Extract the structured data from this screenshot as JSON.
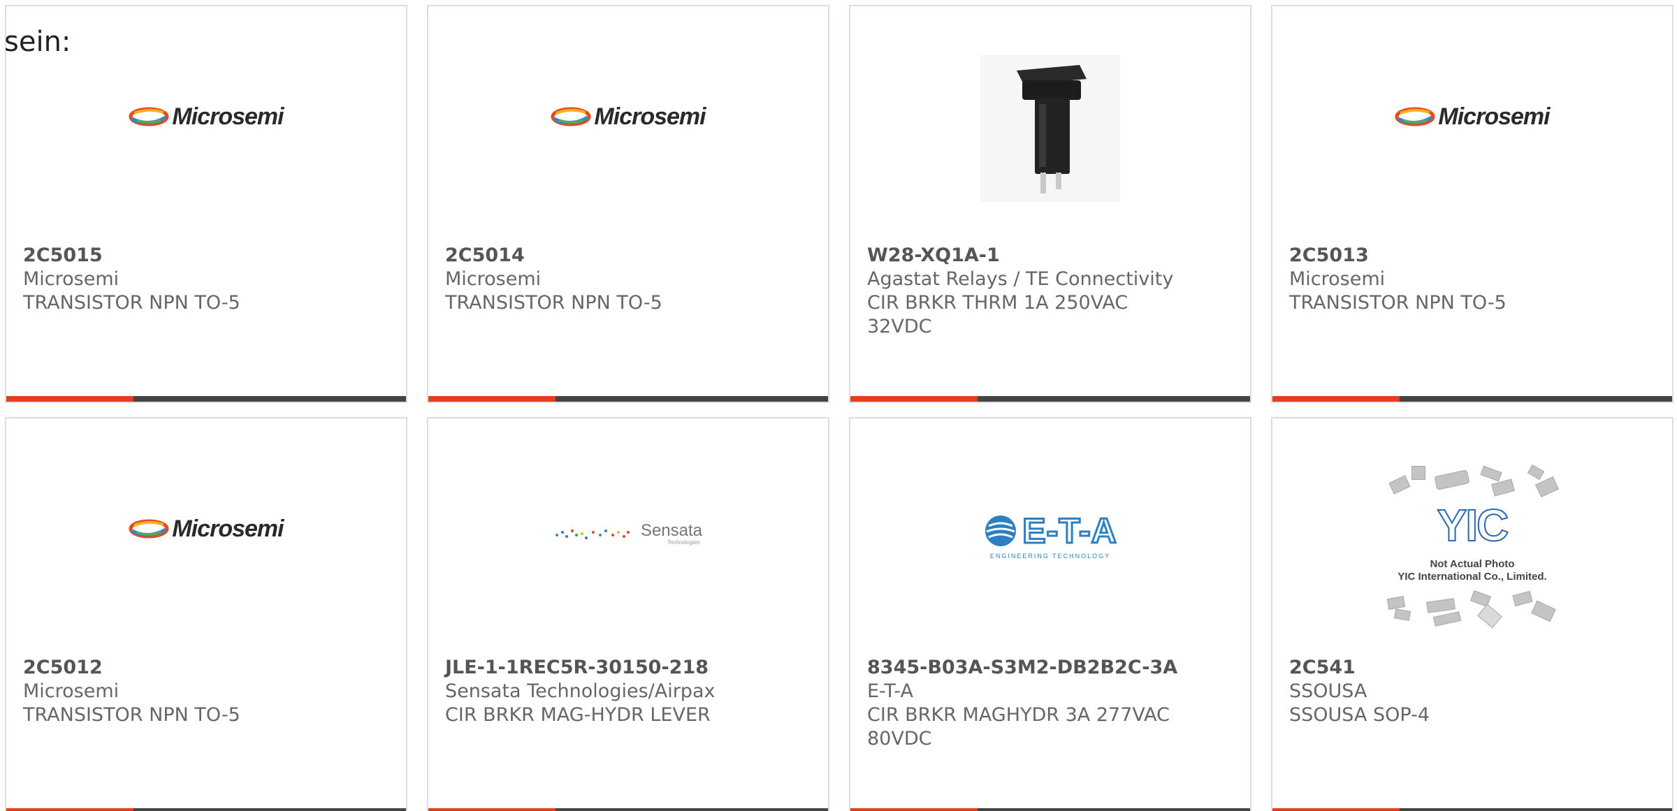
{
  "header": {
    "text": "sein:"
  },
  "colors": {
    "accent": "#e2401c",
    "bar": "#444444",
    "text": "#666666",
    "border": "#dddddd"
  },
  "products": [
    {
      "part_number": "2C5015",
      "manufacturer": "Microsemi",
      "description": "TRANSISTOR NPN TO-5",
      "image": "microsemi-logo"
    },
    {
      "part_number": "2C5014",
      "manufacturer": "Microsemi",
      "description": "TRANSISTOR NPN TO-5",
      "image": "microsemi-logo"
    },
    {
      "part_number": "W28-XQ1A-1",
      "manufacturer": "Agastat Relays / TE Connectivity",
      "description": "CIR BRKR THRM 1A 250VAC 32VDC",
      "image": "circuit-breaker-photo"
    },
    {
      "part_number": "2C5013",
      "manufacturer": "Microsemi",
      "description": "TRANSISTOR NPN TO-5",
      "image": "microsemi-logo"
    },
    {
      "part_number": "2C5012",
      "manufacturer": "Microsemi",
      "description": "TRANSISTOR NPN TO-5",
      "image": "microsemi-logo"
    },
    {
      "part_number": "JLE-1-1REC5R-30150-218",
      "manufacturer": "Sensata Technologies/Airpax",
      "description": "CIR BRKR MAG-HYDR LEVER",
      "image": "sensata-logo"
    },
    {
      "part_number": "8345-B03A-S3M2-DB2B2C-3A",
      "manufacturer": "E-T-A",
      "description": "CIR BRKR MAGHYDR 3A 277VAC 80VDC",
      "image": "eta-logo"
    },
    {
      "part_number": "2C541",
      "manufacturer": "SSOUSA",
      "description": "SSOUSA SOP-4",
      "image": "not-actual-photo-placeholder"
    }
  ],
  "logos": {
    "microsemi": "Microsemi",
    "sensata_name": "Sensata",
    "sensata_sub": "Technologies",
    "eta_name": "E-T-A",
    "eta_sub": "ENGINEERING TECHNOLOGY",
    "yic_name": "YIC",
    "yic_line1": "Not Actual Photo",
    "yic_line2": "YIC International Co., Limited."
  }
}
